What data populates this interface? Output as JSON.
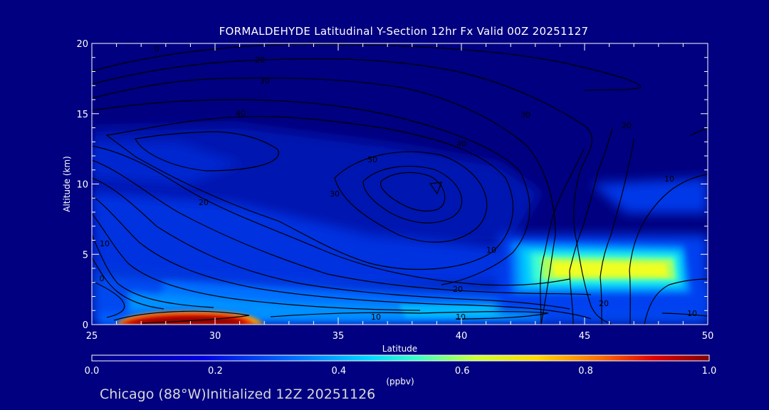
{
  "title": "FORMALDEHYDE Latitudinal Y-Section 12hr  Fx Valid 00Z 20251127",
  "location_label": "Chicago (88°W)Initialized 12Z 20251126",
  "colors": {
    "background": "#000080",
    "frame": "#ffffff",
    "contour": "#000000",
    "text": "#ffffff"
  },
  "chart_data": {
    "type": "heatmap",
    "xlabel": "Latitude",
    "ylabel": "Altitude (km)",
    "xlim": [
      25,
      50
    ],
    "ylim": [
      0,
      20
    ],
    "x_ticks": [
      "25",
      "30",
      "35",
      "40",
      "45",
      "50"
    ],
    "y_ticks": [
      "0",
      "5",
      "10",
      "15",
      "20"
    ],
    "grid": false,
    "colorbar": {
      "label": "(ppbv)",
      "range": [
        0.0,
        1.0
      ],
      "ticks": [
        "0.0",
        "0.2",
        "0.4",
        "0.6",
        "0.8",
        "1.0"
      ],
      "colormap": "rainbow"
    },
    "filled_regions": [
      {
        "feature": "surface maximum",
        "lat_range": [
          26.1,
          31.4
        ],
        "alt_range": [
          0,
          1.1
        ],
        "peak_value": 0.95
      },
      {
        "feature": "northern mid-level band",
        "lat_range": [
          42.3,
          48.3
        ],
        "alt_range": [
          2.6,
          5.4
        ],
        "peak_value": 0.55
      },
      {
        "feature": "near-surface band",
        "lat_range": [
          31,
          42
        ],
        "alt_range": [
          0.2,
          1.2
        ],
        "peak_value": 0.3
      },
      {
        "feature": "upper background",
        "lat_range": [
          25,
          42
        ],
        "alt_range": [
          2,
          14
        ],
        "peak_value": 0.12
      }
    ],
    "contour_labels": [
      "0",
      "20",
      "30",
      "40",
      "50",
      "40",
      "30",
      "20",
      "10",
      "20",
      "10",
      "10",
      "30",
      "20",
      "10",
      "20",
      "10",
      "10",
      "0"
    ]
  }
}
